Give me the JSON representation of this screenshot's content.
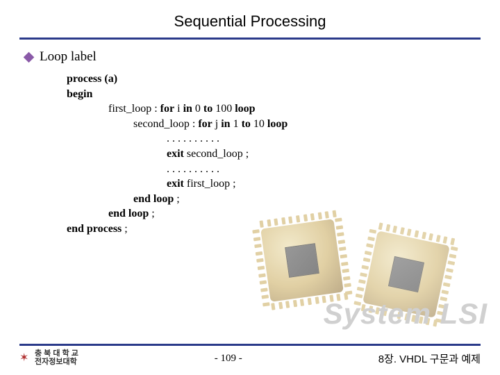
{
  "title": "Sequential Processing",
  "bullet": "Loop label",
  "code": {
    "l1": "process (a)",
    "l2": "begin",
    "l3_pre": "               first_loop : ",
    "l3_for": "for",
    "l3_mid1": " i ",
    "l3_in": "in",
    "l3_mid2": " 0 ",
    "l3_to": "to",
    "l3_mid3": " 100 ",
    "l3_loop": "loop",
    "l4_pre": "                        second_loop : ",
    "l4_for": "for",
    "l4_mid1": " j ",
    "l4_in": "in",
    "l4_mid2": " 1 ",
    "l4_to": "to",
    "l4_mid3": " 10 ",
    "l4_loop": "loop",
    "l5": "                                    . . . . . . . . . .",
    "l6_pre": "                                    ",
    "l6_exit": "exit",
    "l6_post": " second_loop ;",
    "l7": "                                    . . . . . . . . . .",
    "l8_pre": "                                    ",
    "l8_exit": "exit",
    "l8_post": " first_loop ;",
    "l9_pre": "                        ",
    "l9_end": "end loop",
    "l9_post": " ;",
    "l10_pre": "               ",
    "l10_end": "end loop",
    "l10_post": " ;",
    "l11_end": "end process",
    "l11_post": " ;"
  },
  "watermark": "System LSI",
  "footer": {
    "uni_line1": "충 북 대 학 교",
    "uni_line2": "전자정보대학",
    "page": "-  109  -",
    "right": "8장. VHDL 구문과 예제"
  }
}
